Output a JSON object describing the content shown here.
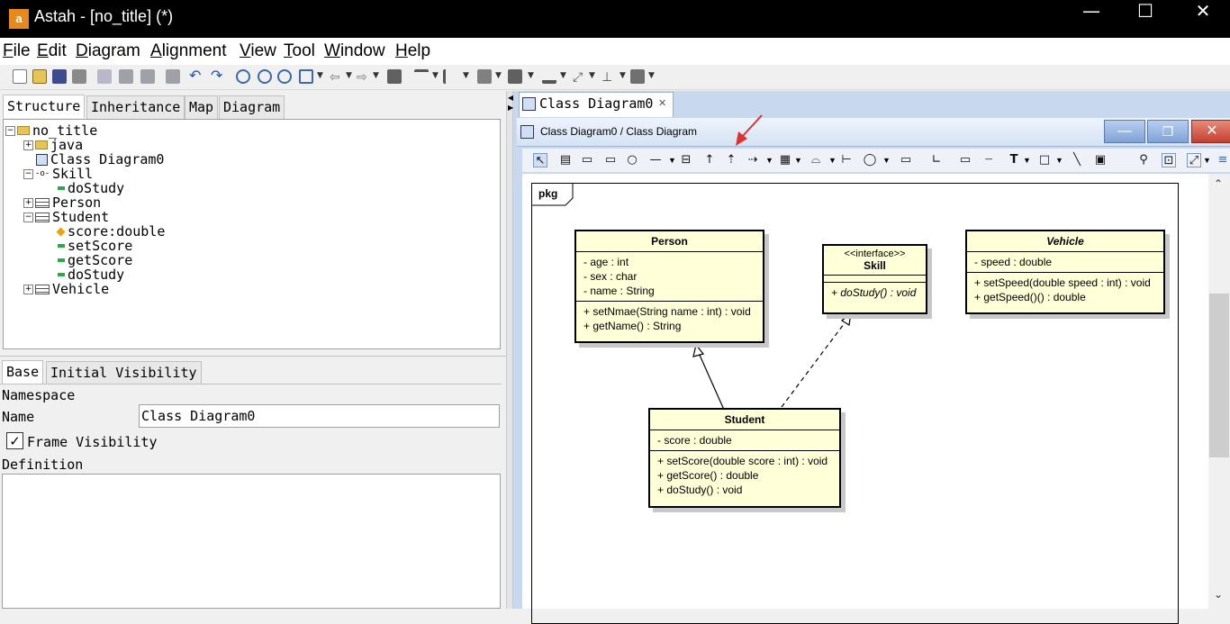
{
  "window": {
    "logo": "a",
    "title": "Astah - [no_title] (*)",
    "controls": {
      "minimize": "—",
      "maximize": "☐",
      "close": "✕"
    }
  },
  "menu": [
    {
      "label": "File",
      "accel": "F",
      "rest": "ile"
    },
    {
      "label": "Edit",
      "accel": "E",
      "rest": "dit"
    },
    {
      "label": "Diagram",
      "accel": "D",
      "rest": "iagram"
    },
    {
      "label": "Alignment",
      "accel": "A",
      "rest": "lignment"
    },
    {
      "label": "View",
      "accel": "V",
      "rest": "iew"
    },
    {
      "label": "Tool",
      "accel": "T",
      "rest": "ool"
    },
    {
      "label": "Window",
      "accel": "W",
      "rest": "indow"
    },
    {
      "label": "Help",
      "accel": "H",
      "rest": "elp"
    }
  ],
  "left_tabs": [
    "Structure",
    "Inheritance",
    "Map",
    "Diagram"
  ],
  "tree": {
    "root": "no_title",
    "java": "java",
    "diagram": "Class Diagram0",
    "skill": "Skill",
    "skill_op": "doStudy",
    "person": "Person",
    "student": "Student",
    "student_attr": "score:double",
    "student_op1": "setScore",
    "student_op2": "getScore",
    "student_op3": "doStudy",
    "vehicle": "Vehicle"
  },
  "prop_tabs": [
    "Base",
    "Initial Visibility"
  ],
  "props": {
    "namespace_label": "Namespace",
    "name_label": "Name",
    "name_value": "Class Diagram0",
    "frame_visibility": "Frame Visibility",
    "frame_checked": "✓",
    "definition_label": "Definition"
  },
  "diagram_tab": {
    "label": "Class Diagram0",
    "close": "✕"
  },
  "inner_window": {
    "title": "Class Diagram0 / Class Diagram"
  },
  "frame_label": "pkg",
  "classes": {
    "person": {
      "name": "Person",
      "attrs": [
        "- age : int",
        "- sex : char",
        "- name : String"
      ],
      "ops": [
        "+ setNmae(String name : int) : void",
        "+ getName() : String"
      ]
    },
    "skill": {
      "stereo": "<<interface>>",
      "name": "Skill",
      "ops": [
        "+ doStudy() : void"
      ]
    },
    "vehicle": {
      "name": "Vehicle",
      "attrs": [
        "- speed : double"
      ],
      "ops": [
        "+ setSpeed(double speed : int) : void",
        "+ getSpeed()() : double"
      ]
    },
    "student": {
      "name": "Student",
      "attrs": [
        "- score : double"
      ],
      "ops": [
        "+ setScore(double score : int) : void",
        "+ getScore() : double",
        "+ doStudy() : void"
      ]
    }
  },
  "colors": {
    "class_fill": "#ffffd8",
    "annotation_arrow": "#e03030"
  }
}
